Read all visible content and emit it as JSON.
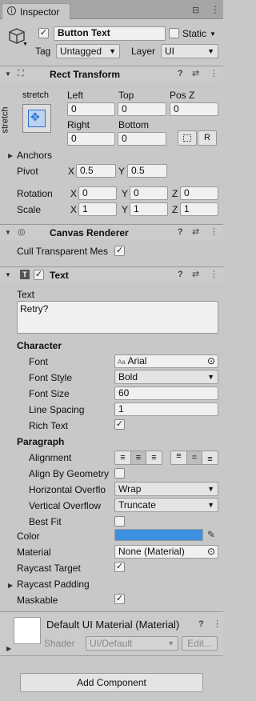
{
  "tab": {
    "title": "Inspector"
  },
  "object": {
    "name": "Button Text",
    "static_label": "Static",
    "tag_label": "Tag",
    "tag_value": "Untagged",
    "layer_label": "Layer",
    "layer_value": "UI"
  },
  "rect": {
    "title": "Rect Transform",
    "stretch_top": "stretch",
    "stretch_side": "stretch",
    "left_label": "Left",
    "top_label": "Top",
    "posz_label": "Pos Z",
    "left": "0",
    "top": "0",
    "posz": "0",
    "right_label": "Right",
    "bottom_label": "Bottom",
    "right": "0",
    "bottom": "0",
    "r_button": "R",
    "anchors_label": "Anchors",
    "pivot_label": "Pivot",
    "pivot_x_label": "X",
    "pivot_x": "0.5",
    "pivot_y_label": "Y",
    "pivot_y": "0.5",
    "rotation_label": "Rotation",
    "rot_x": "0",
    "rot_y": "0",
    "rot_z": "0",
    "scale_label": "Scale",
    "scale_x": "1",
    "scale_y": "1",
    "scale_z": "1",
    "x": "X",
    "y": "Y",
    "z": "Z"
  },
  "canvas": {
    "title": "Canvas Renderer",
    "cull_label": "Cull Transparent Mes"
  },
  "text": {
    "title": "Text",
    "text_label": "Text",
    "text_value": "Retry?",
    "character_label": "Character",
    "font_label": "Font",
    "font_value": "Arial",
    "font_style_label": "Font Style",
    "font_style_value": "Bold",
    "font_size_label": "Font Size",
    "font_size_value": "60",
    "line_spacing_label": "Line Spacing",
    "line_spacing_value": "1",
    "rich_text_label": "Rich Text",
    "paragraph_label": "Paragraph",
    "alignment_label": "Alignment",
    "align_geometry_label": "Align By Geometry",
    "h_overflow_label": "Horizontal Overflo",
    "h_overflow_value": "Wrap",
    "v_overflow_label": "Vertical Overflow",
    "v_overflow_value": "Truncate",
    "best_fit_label": "Best Fit",
    "color_label": "Color",
    "color_value": "#3d8fe0",
    "material_label": "Material",
    "material_value": "None (Material)",
    "raycast_target_label": "Raycast Target",
    "raycast_padding_label": "Raycast Padding",
    "maskable_label": "Maskable"
  },
  "material": {
    "name": "Default UI Material (Material)",
    "shader_label": "Shader",
    "shader_value": "UI/Default",
    "edit_label": "Edit..."
  },
  "add_component_label": "Add Component",
  "icons": {
    "check": "✓",
    "help": "?",
    "settings": "⇄",
    "menu": "⋮",
    "fold_open": "▼",
    "fold_closed": "▶",
    "dropdown": "▼",
    "target": "⊙",
    "pick": "✎",
    "lock": "🔒"
  }
}
